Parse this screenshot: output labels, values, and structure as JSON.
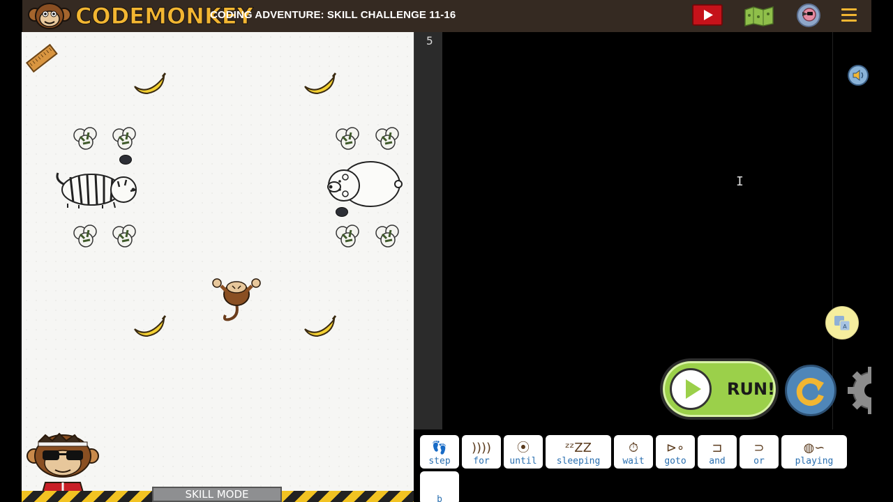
{
  "header": {
    "logo_text": "CODEMONKEY",
    "challenge_title": "CODING ADVENTURE: SKILL CHALLENGE 11-16",
    "buttons": [
      "video-tutorial",
      "map",
      "avatar",
      "menu"
    ]
  },
  "game": {
    "skill_mode_label": "SKILL MODE",
    "icons": {
      "ruler": "ruler-icon",
      "banana": "banana-icon",
      "bush": "bush-icon",
      "rock": "rock-icon",
      "tiger": "tiger-icon",
      "polar_bear": "polar-bear-icon",
      "monkey": "monkey-icon"
    }
  },
  "editor": {
    "line_number": "5",
    "run_label": "RUN!",
    "cursor": "I"
  },
  "palette": {
    "commands": [
      {
        "label": "step",
        "icon": "footprints-icon"
      },
      {
        "label": "for",
        "icon": "loop-icon"
      },
      {
        "label": "until",
        "icon": "until-icon"
      },
      {
        "label": "sleeping",
        "icon": "zzz-icon"
      },
      {
        "label": "wait",
        "icon": "stopwatch-icon"
      },
      {
        "label": "goto",
        "icon": "goto-icon"
      },
      {
        "label": "and",
        "icon": "and-gate-icon"
      },
      {
        "label": "or",
        "icon": "or-gate-icon"
      },
      {
        "label": "playing",
        "icon": "yarn-icon"
      }
    ],
    "variable": "b"
  },
  "colors": {
    "topbar": "#352a22",
    "logo": "#f2b632",
    "run_green": "#9bd04a",
    "reset_blue": "#4f86b8",
    "code_blue": "#2a6fb0",
    "hazard_yellow": "#f2c322"
  }
}
